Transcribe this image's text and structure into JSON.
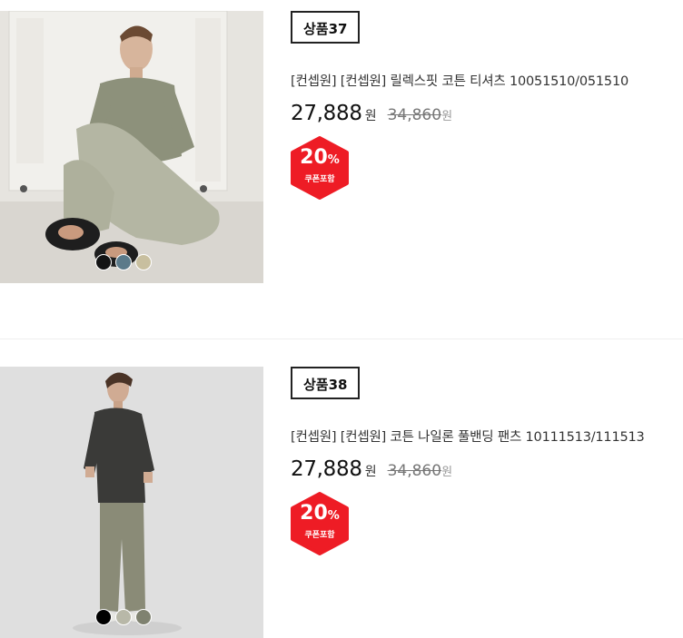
{
  "products": [
    {
      "badge": "상품37",
      "title": "[컨셉원] [컨셉원] 릴렉스핏 코튼 티셔츠 10051510/051510",
      "price": "27,888",
      "price_unit": "원",
      "original_price": "34,860",
      "original_unit": "원",
      "discount_percent": "20",
      "percent_sign": "%",
      "coupon_label": "쿠폰포함",
      "swatches": [
        "#141414",
        "#5b7a8a",
        "#c8bf9f"
      ]
    },
    {
      "badge": "상품38",
      "title": "[컨셉원] [컨셉원] 코튼 나일론 풀밴딩 팬츠 10111513/111513",
      "price": "27,888",
      "price_unit": "원",
      "original_price": "34,860",
      "original_unit": "원",
      "discount_percent": "20",
      "percent_sign": "%",
      "coupon_label": "쿠폰포함",
      "swatches": [
        "#000000",
        "#b8b8a8",
        "#7f8270"
      ]
    }
  ],
  "colors": {
    "coupon_red": "#ee1c25",
    "text_dark": "#111111",
    "text_strike": "#777777"
  }
}
